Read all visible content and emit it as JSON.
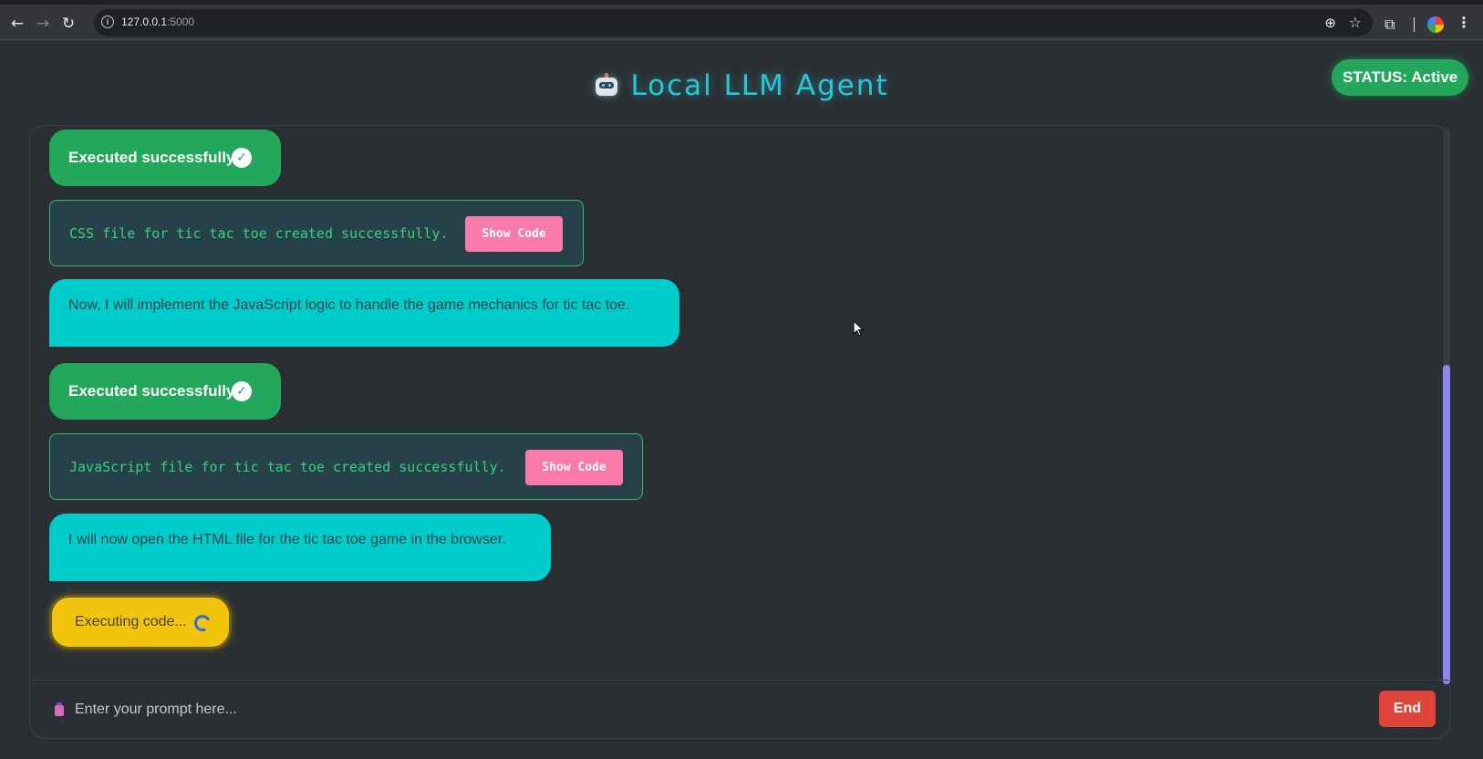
{
  "browser": {
    "url_host": "127.0.0.1",
    "url_port": ":5000",
    "icons": [
      "back-icon",
      "forward-icon",
      "reload-icon",
      "site-info-icon",
      "zoom-icon",
      "bookmark-star-icon",
      "extensions-icon",
      "profile-avatar",
      "menu-icon"
    ]
  },
  "header": {
    "title": "Local LLM Agent",
    "icon": "robot-icon",
    "status": "STATUS: Active"
  },
  "messages": [
    {
      "type": "success",
      "text": "Executed successfully."
    },
    {
      "type": "file",
      "text": "CSS file for tic tac toe created successfully.",
      "button": "Show Code"
    },
    {
      "type": "agent",
      "text": "Now, I will implement the JavaScript logic to handle the game mechanics for tic tac toe."
    },
    {
      "type": "success",
      "text": "Executed successfully."
    },
    {
      "type": "file",
      "text": "JavaScript file for tic tac toe created successfully.",
      "button": "Show Code"
    },
    {
      "type": "agent",
      "text": "I will now open the HTML file for the tic tac toe game in the browser."
    },
    {
      "type": "executing",
      "text": "Executing code..."
    }
  ],
  "input": {
    "placeholder": "Enter your prompt here...",
    "end_label": "End"
  },
  "colors": {
    "accent": "#29c6d8",
    "success": "#23a85b",
    "agent_bubble": "#00cccc",
    "executing": "#f3c40e",
    "show_code": "#f77aa8",
    "end_button": "#e0443a",
    "scroll_thumb": "#8f86f0"
  }
}
